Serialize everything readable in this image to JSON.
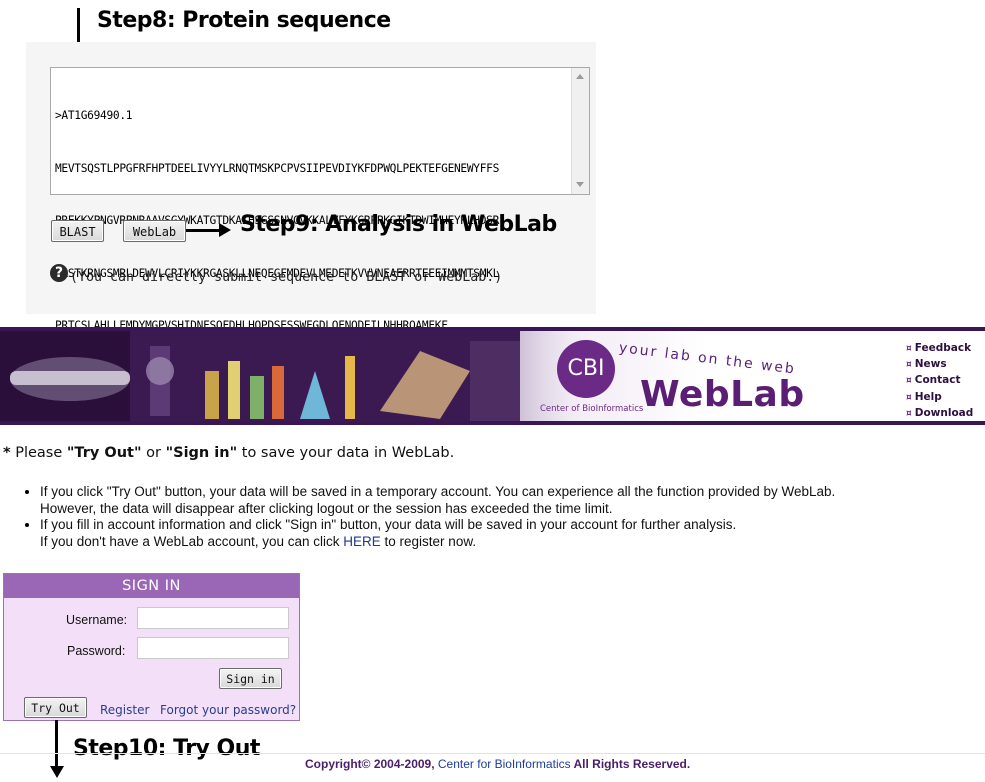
{
  "annotations": {
    "step8": "Step8: Protein sequence",
    "step9": "Step9: Analysis in WebLab",
    "step10": "Step10:  Try Out"
  },
  "sequence_panel": {
    "lines": [
      ">AT1G69490.1",
      "MEVTSQSTLPPGFRFHPTDEELIVYYLRNQTMSKPCPVSIIPEVDIYKFDPWQLPEKTEFGENEWYFFS",
      "PREKKYPNGVRPNRAAVSGYWKATGTDKAIHSGSSNVGVKKALVFYKGRPPKGIKTDWIMHEYRLHDSR",
      "KASTKRNGSMRLDEWVLCRIYKKRGASKLLNEQEGFMDEVLMEDETKVVVNEAERRTEEEIMMMTSMKL",
      "PRTCSLAHLLEMDYMGPVSHIDNFSQFDHLHQPDSESSWFGDLQFNQDEILNHHRQAMFKF"
    ],
    "blast_label": "BLAST",
    "weblab_label": "WebLab",
    "note": "(You can directly submit sequence to BLAST or WebLab.)",
    "note_icon": "question-icon"
  },
  "banner": {
    "logo_text": "CBI",
    "center_arc": "Center of BioInformatics",
    "tagline": "your lab on the web",
    "title": "WebLab",
    "links": [
      "Feedback",
      "News",
      "Contact",
      "Help",
      "Download"
    ],
    "link_bullet": "¤"
  },
  "notice": {
    "star": "*",
    "prefix": "Please ",
    "try_out": "\"Try Out\"",
    "or": " or ",
    "sign_in": "\"Sign in\"",
    "suffix": " to save your data in WebLab."
  },
  "bullets": [
    {
      "line1": "If you click \"Try Out\" button, your data will be saved in a temporary account. You can experience all the function provided by WebLab.",
      "line2": "However, the data will disappear after clicking logout or the session has exceeded the time limit."
    },
    {
      "line1": "If you fill in account information and click \"Sign in\" button, your data will be saved in your account for further analysis.",
      "line2_pre": "If you don't have a WebLab account, you can click ",
      "line2_link": "HERE",
      "line2_post": " to register now."
    }
  ],
  "signin": {
    "header": "SIGN IN",
    "username_label": "Username:",
    "username_value": "",
    "password_label": "Password:",
    "password_value": "",
    "signin_button": "Sign in",
    "tryout_button": "Try Out",
    "register_link": "Register",
    "forgot_link": "Forgot your password?"
  },
  "footer": {
    "prefix": "Copyright© 2004-2009, ",
    "org": "Center for BioInformatics",
    "suffix": " All Rights Reserved."
  },
  "colors": {
    "banner_purple": "#3a1654",
    "title_purple": "#5a1f75",
    "signin_bg": "#f3dff7",
    "signin_header": "#9a66b6",
    "link_blue": "#2a3d8f"
  }
}
